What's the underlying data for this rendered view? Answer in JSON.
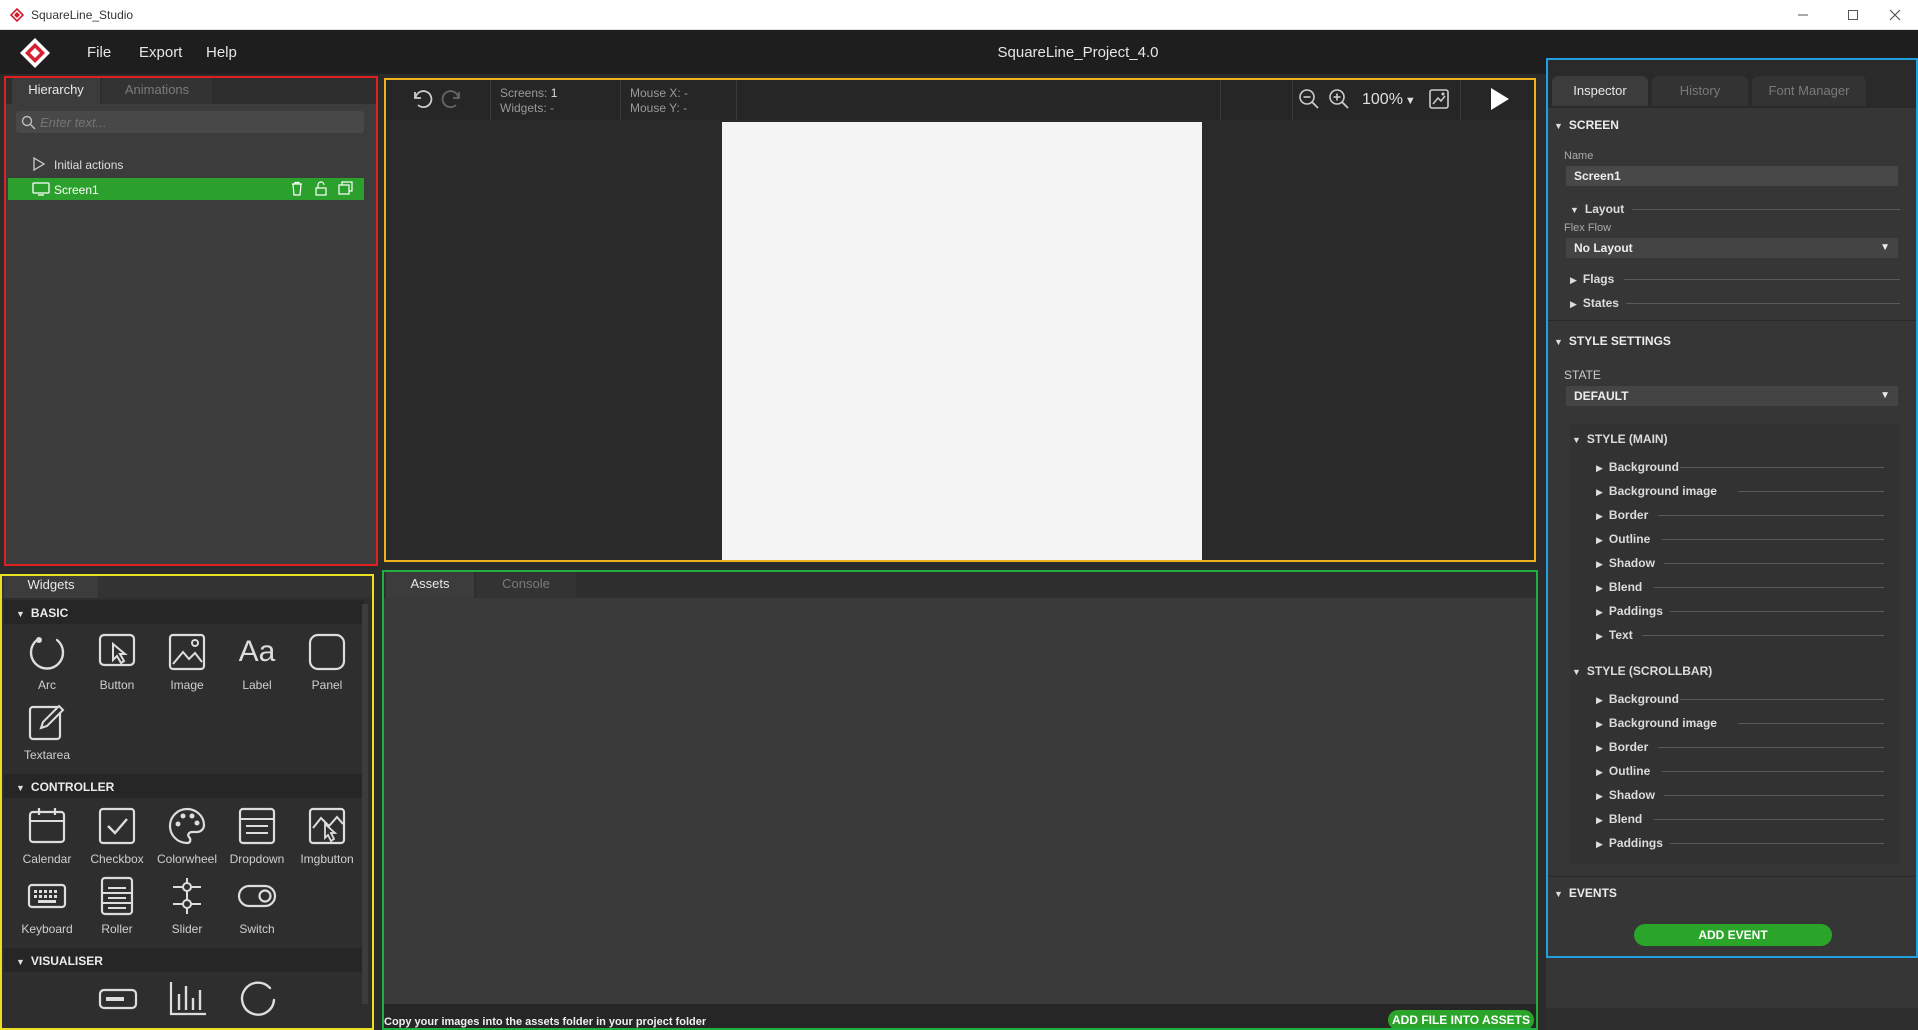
{
  "window": {
    "title": "SquareLine_Studio"
  },
  "menubar": {
    "items": [
      "File",
      "Export",
      "Help"
    ],
    "project_title": "SquareLine_Project_4.0"
  },
  "hierarchy": {
    "tabs": [
      "Hierarchy",
      "Animations"
    ],
    "search_placeholder": "Enter text...",
    "items": [
      {
        "label": "Initial actions"
      },
      {
        "label": "Screen1"
      }
    ]
  },
  "canvas": {
    "screens_label": "Screens:",
    "screens_value": "1",
    "widgets_label": "Widgets:",
    "widgets_value": "-",
    "mouse_x_label": "Mouse X:",
    "mouse_x_value": "-",
    "mouse_y_label": "Mouse Y:",
    "mouse_y_value": "-",
    "zoom": "100%"
  },
  "widgets": {
    "tab": "Widgets",
    "sections": [
      {
        "title": "BASIC",
        "items": [
          "Arc",
          "Button",
          "Image",
          "Label",
          "Panel",
          "Textarea"
        ]
      },
      {
        "title": "CONTROLLER",
        "items": [
          "Calendar",
          "Checkbox",
          "Colorwheel",
          "Dropdown",
          "Imgbutton",
          "Keyboard",
          "Roller",
          "Slider",
          "Switch"
        ]
      },
      {
        "title": "VISUALISER",
        "items": []
      }
    ],
    "basic_label_glyph": "Aa"
  },
  "assets": {
    "tabs": [
      "Assets",
      "Console"
    ],
    "hint": "Copy your images into the assets folder in your project folder",
    "add_button": "ADD FILE INTO ASSETS"
  },
  "inspector": {
    "tabs": [
      "Inspector",
      "History",
      "Font Manager"
    ],
    "screen_section": "SCREEN",
    "name_label": "Name",
    "name_value": "Screen1",
    "layout_label": "Layout",
    "flex_flow_label": "Flex Flow",
    "flex_flow_value": "No Layout",
    "flags_label": "Flags",
    "states_label": "States",
    "style_settings": "STYLE SETTINGS",
    "state_label": "STATE",
    "state_value": "DEFAULT",
    "style_main": "STYLE (MAIN)",
    "style_main_items": [
      "Background",
      "Background image",
      "Border",
      "Outline",
      "Shadow",
      "Blend",
      "Paddings",
      "Text"
    ],
    "style_scrollbar": "STYLE (SCROLLBAR)",
    "style_scrollbar_items": [
      "Background",
      "Background image",
      "Border",
      "Outline",
      "Shadow",
      "Blend",
      "Paddings"
    ],
    "events": "EVENTS",
    "add_event": "ADD EVENT"
  },
  "colors": {
    "accent_green": "#2aa52a",
    "selection_green": "#2ca02c",
    "highlight_red": "#e02020",
    "highlight_orange": "#f0b020",
    "highlight_yellow": "#e8e020",
    "highlight_green": "#20b040",
    "highlight_blue": "#20a0e0"
  }
}
